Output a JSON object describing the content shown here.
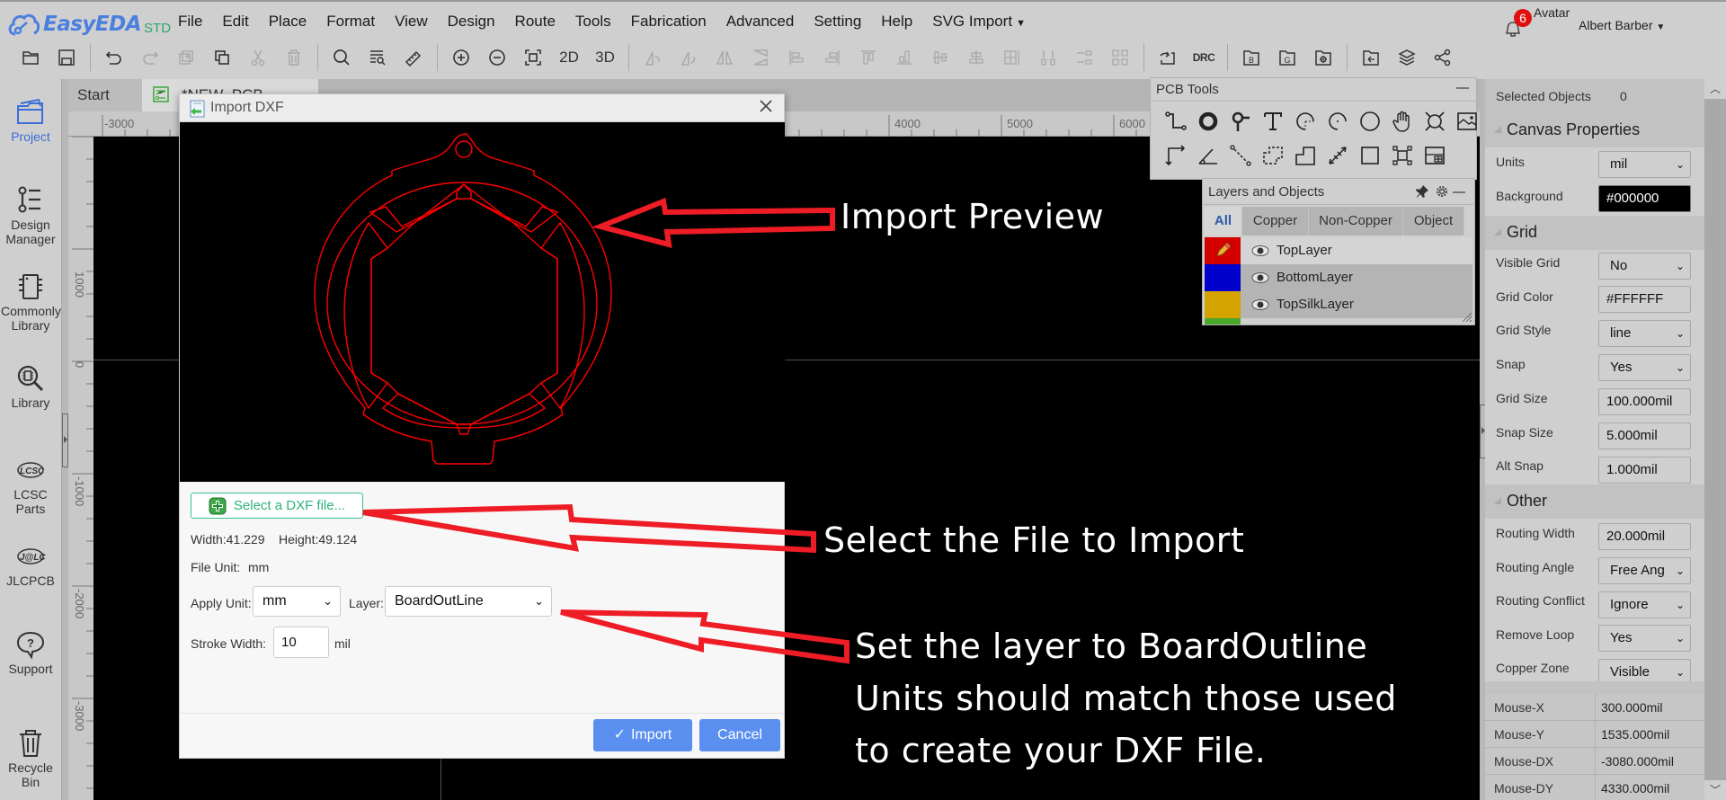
{
  "app": {
    "logo_text": "EasyEDA",
    "logo_suffix": "STD",
    "brand_color": "#4a7fe0"
  },
  "menu": [
    "File",
    "Edit",
    "Place",
    "Format",
    "View",
    "Design",
    "Route",
    "Tools",
    "Fabrication",
    "Advanced",
    "Setting",
    "Help",
    "SVG Import"
  ],
  "toolbar": {
    "view_2d": "2D",
    "view_3d": "3D",
    "drc": "DRC",
    "icons": [
      "open-folder",
      "save",
      "undo",
      "redo",
      "duplicate",
      "copy",
      "cut",
      "delete",
      "search",
      "find-list",
      "measure",
      "zoom-in",
      "zoom-out",
      "fit-view",
      "2d",
      "3d",
      "rotate-left",
      "rotate-right",
      "flip-horizontal",
      "flip-vertical",
      "align-left",
      "align-right",
      "align-top",
      "align-bottom",
      "align-center-h",
      "align-center-v",
      "grid-align",
      "distribute-h",
      "distribute-v",
      "group",
      "import-changes",
      "drc",
      "bom",
      "gerber",
      "pick-place",
      "import-file",
      "layers",
      "share"
    ]
  },
  "user": {
    "notifications": "6",
    "avatar_label": "Avatar",
    "name": "Albert Barber"
  },
  "sidebar": {
    "items": [
      {
        "label": "Project",
        "icon": "folder-icon"
      },
      {
        "label": "Design Manager",
        "icon": "design-manager-icon"
      },
      {
        "label": "Commonly Library",
        "icon": "chip-icon"
      },
      {
        "label": "Library",
        "icon": "library-search-icon"
      },
      {
        "label": "LCSC Parts",
        "icon": "lcsc-logo-icon"
      },
      {
        "label": "JLCPCB",
        "icon": "jlc-logo-icon"
      },
      {
        "label": "Support",
        "icon": "help-bubble-icon"
      },
      {
        "label": "Recycle Bin",
        "icon": "trash-icon"
      }
    ]
  },
  "tabs": [
    {
      "label": "Start"
    },
    {
      "label": "*NEW_PCB"
    }
  ],
  "rulers": {
    "top": [
      "-3000",
      "4000",
      "5000",
      "6000"
    ],
    "left": [
      "1000",
      "0",
      "-1000",
      "-2000",
      "-3000"
    ]
  },
  "dialog": {
    "title": "Import DXF",
    "select_file_label": "Select a DXF file...",
    "width_label": "Width:41.229",
    "height_label": "Height:49.124",
    "file_unit_label": "File Unit:",
    "file_unit_value": "mm",
    "apply_unit_label": "Apply Unit:",
    "apply_unit_value": "mm",
    "layer_label": "Layer:",
    "layer_value": "BoardOutLine",
    "stroke_width_label": "Stroke Width:",
    "stroke_width_value": "10",
    "stroke_width_unit": "mil",
    "import_label": "Import",
    "cancel_label": "Cancel",
    "preview_stroke_color": "#ff0000"
  },
  "annotations": {
    "preview": "Import Preview",
    "select_file": "Select the File to Import",
    "layer_line1": "Set the layer to BoardOutline",
    "layer_line2": "Units should match those used",
    "layer_line3": "to create your DXF File.",
    "arrow_color": "#ee1c25"
  },
  "pcb_tools": {
    "title": "PCB Tools",
    "row1": [
      "track",
      "pad",
      "via",
      "text",
      "arc",
      "center-arc",
      "circle",
      "pan-hand",
      "hole",
      "image"
    ],
    "row2": [
      "connect-pad",
      "protractor",
      "line-dimension",
      "solid-region",
      "copper-area",
      "dimension",
      "rectangle",
      "group-ungroup",
      "layout-panel"
    ]
  },
  "layers_panel": {
    "title": "Layers and Objects",
    "tabs": [
      "All",
      "Copper",
      "Non-Copper",
      "Object"
    ],
    "layers": [
      {
        "name": "TopLayer",
        "color": "#d40000",
        "active": true
      },
      {
        "name": "BottomLayer",
        "color": "#0000cc",
        "active": false
      },
      {
        "name": "TopSilkLayer",
        "color": "#d4a300",
        "active": false
      }
    ],
    "next_layer_color": "#4aa82a"
  },
  "right_panel": {
    "selected_objects_label": "Selected Objects",
    "selected_objects_value": "0",
    "canvas_header": "Canvas Properties",
    "units_label": "Units",
    "units_value": "mil",
    "background_label": "Background",
    "background_value": "#000000",
    "grid_header": "Grid",
    "visible_grid_label": "Visible Grid",
    "visible_grid_value": "No",
    "grid_color_label": "Grid Color",
    "grid_color_value": "#FFFFFF",
    "grid_style_label": "Grid Style",
    "grid_style_value": "line",
    "snap_label": "Snap",
    "snap_value": "Yes",
    "grid_size_label": "Grid Size",
    "grid_size_value": "100.000mil",
    "snap_size_label": "Snap Size",
    "snap_size_value": "5.000mil",
    "alt_snap_label": "Alt Snap",
    "alt_snap_value": "1.000mil",
    "other_header": "Other",
    "routing_width_label": "Routing Width",
    "routing_width_value": "20.000mil",
    "routing_angle_label": "Routing Angle",
    "routing_angle_value": "Free Ang",
    "routing_conflict_label": "Routing Conflict",
    "routing_conflict_value": "Ignore",
    "remove_loop_label": "Remove Loop",
    "remove_loop_value": "Yes",
    "copper_zone_label": "Copper Zone",
    "copper_zone_value": "Visible",
    "mouse": [
      {
        "key": "Mouse-X",
        "value": "300.000mil"
      },
      {
        "key": "Mouse-Y",
        "value": "1535.000mil"
      },
      {
        "key": "Mouse-DX",
        "value": "-3080.000mil"
      },
      {
        "key": "Mouse-DY",
        "value": "4330.000mil"
      }
    ]
  }
}
